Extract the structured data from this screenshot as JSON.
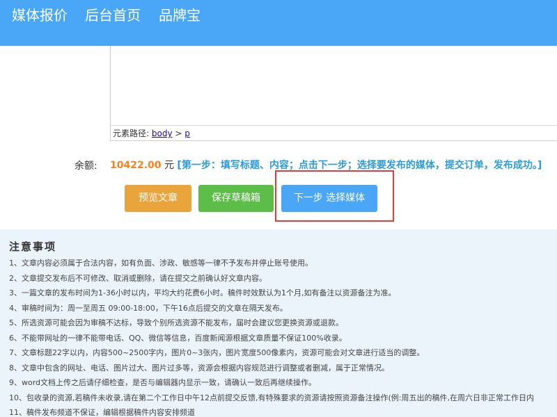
{
  "header": {
    "nav": [
      "媒体报价",
      "后台首页",
      "品牌宝"
    ]
  },
  "editor": {
    "path_label": "元素路径:",
    "path_body": "body",
    "path_sep": ">",
    "path_p": "p"
  },
  "balance": {
    "label": "余额:",
    "amount": "10422.00",
    "unit": "元",
    "steps": "[第一步：填写标题、内容；点击下一步；选择要发布的媒体，提交订单，发布成功。]"
  },
  "actions": {
    "preview": "预览文章",
    "draft": "保存草稿箱",
    "next": "下一步 选择媒体"
  },
  "notice": {
    "title": "注意事项",
    "items": [
      "1、文章内容必须属于合法内容，如有负面、涉政、敏感等一律不予发布并停止账号使用。",
      "2、文章提交发布后不可修改、取消或删除，请在提交之前确认好文章内容。",
      "3、一篇文章的发布时间为1-36小时以内，平均大约花费6小时。稿件时效默认为1个月,如有备注以资源备注为准。",
      "4、审稿时间为：周一至周五 09:00-18:00，下午16点后提交的文章在隔天发布。",
      "5、所选资源可能会因为审稿不达标，导致个别所选资源不能发布，届时会建议您更换资源或退款。",
      "6、不能带网址的一律不能带电话、QQ、微信等信息，百度新闻源根据文章质量不保证100%收录。",
      "7、文章标题22字以内，内容500~2500字内，图片0~3张内，图片宽度500像素内，资源可能会对文章进行适当的调整。",
      "8、文章中包含的网址、电话、图片过大、图片过多等，资源会根据内容规范进行调整或者删减，属于正常情况。",
      "9、word文档上传之后请仔细检查，是否与编辑器内显示一致，请确认一致后再继续操作。",
      "10、包收录的资源,若稿件未收录,请在第二个工作日中午12点前提交反馈,有特殊要求的资源请按照资源备注操作(例:周五出的稿件,在周六日非正常工作日内",
      "11、稿件发布频道不保证，编辑根据稿件内容安排频道"
    ]
  }
}
